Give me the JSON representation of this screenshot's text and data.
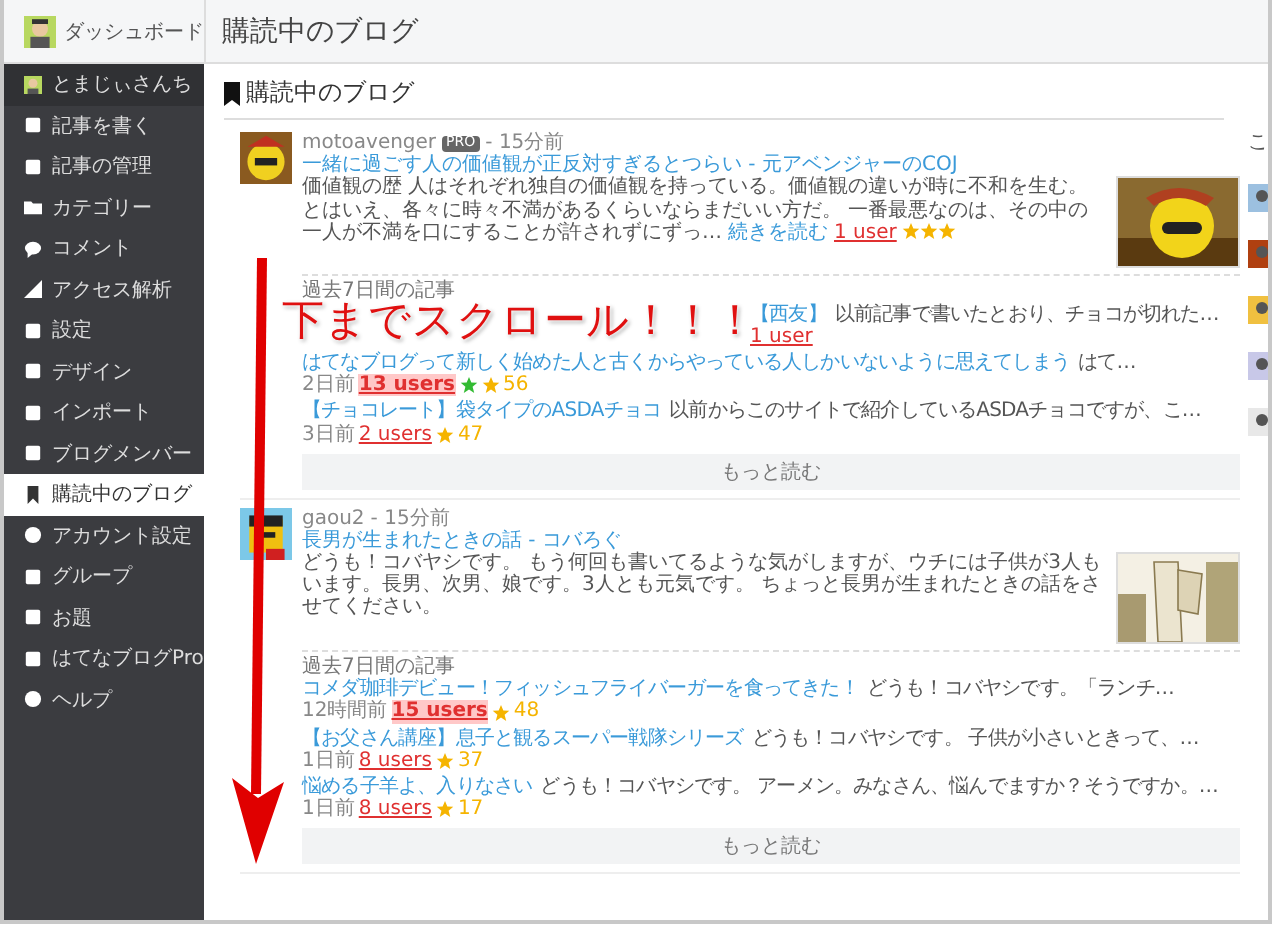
{
  "header": {
    "dashboard_label": "ダッシュボード",
    "title": "購読中のブログ"
  },
  "sidebar": {
    "items": [
      {
        "label": "とまじぃさんち",
        "selected": false
      },
      {
        "label": "記事を書く",
        "selected": false
      },
      {
        "label": "記事の管理",
        "selected": false
      },
      {
        "label": "カテゴリー",
        "selected": false
      },
      {
        "label": "コメント",
        "selected": false
      },
      {
        "label": "アクセス解析",
        "selected": false
      },
      {
        "label": "設定",
        "selected": false
      },
      {
        "label": "デザイン",
        "selected": false
      },
      {
        "label": "インポート",
        "selected": false
      },
      {
        "label": "ブログメンバー",
        "selected": false
      },
      {
        "label": "購読中のブログ",
        "selected": true
      },
      {
        "label": "アカウント設定",
        "selected": false
      },
      {
        "label": "グループ",
        "selected": false
      },
      {
        "label": "お題",
        "selected": false
      },
      {
        "label": "はてなブログPro",
        "selected": false
      },
      {
        "label": "ヘルプ",
        "selected": false
      }
    ]
  },
  "main": {
    "heading": "購読中のブログ",
    "annotation": "下までスクロール！！！",
    "right_column_text": "こ",
    "feeds": [
      {
        "author": "motoavenger",
        "pro_badge": "PRO",
        "time": "- 15分前",
        "title": "一緒に過ごす人の価値観が正反対すぎるとつらい - 元アベンジャーのCOJ",
        "excerpt": "価値観の歴 人はそれぞれ独自の価値観を持っている。価値観の違いが時に不和を生む。とはいえ、各々に時々不満があるくらいならまだいい方だ。 一番最悪なのは、その中の一人が不満を口にすることが許されずにずっ…",
        "read_more": "続きを読む",
        "users": "1 user",
        "stars": 3,
        "recent_label": "過去7日間の記事",
        "more": "もっと読む",
        "recent": [
          {
            "title": "【西友】",
            "excerpt": "以前記事で書いたとおり、チョコが切れた…",
            "users": "1 user",
            "hot": false,
            "green_star": false,
            "covered": true
          },
          {
            "title": "はてなブログって新しく始めた人と古くからやっている人しかいないように思えてしまう",
            "excerpt": "はて…",
            "age": "2日前",
            "users": "13 users",
            "hot": true,
            "star_count": "56",
            "green_star": true,
            "covered": false
          },
          {
            "title": "【チョコレート】袋タイプのASDAチョコ",
            "excerpt": "以前からこのサイトで紹介しているASDAチョコですが、こ…",
            "age": "3日前",
            "users": "2 users",
            "hot": false,
            "star_count": "47",
            "green_star": false,
            "covered": false
          }
        ]
      },
      {
        "author": "gaou2",
        "time": "- 15分前",
        "title": "長男が生まれたときの話 - コバろぐ",
        "excerpt": "どうも！コバヤシです。 もう何回も書いてるような気がしますが、ウチには子供が3人もいます。長男、次男、娘です。3人とも元気です。 ちょっと長男が生まれたときの話をさせてください。",
        "recent_label": "過去7日間の記事",
        "more": "もっと読む",
        "recent": [
          {
            "title": "コメダ珈琲デビュー！フィッシュフライバーガーを食ってきた！",
            "excerpt": "どうも！コバヤシです。「ランチ…",
            "age": "12時間前",
            "users": "15 users",
            "hot": true,
            "star_count": "48",
            "green_star": false,
            "covered": false
          },
          {
            "title": "【お父さん講座】息子と観るスーパー戦隊シリーズ",
            "excerpt": "どうも！コバヤシです。 子供が小さいときって、…",
            "age": "1日前",
            "users": "8 users",
            "hot": false,
            "star_count": "37",
            "green_star": false,
            "covered": false
          },
          {
            "title": "悩める子羊よ、入りなさい",
            "excerpt": "どうも！コバヤシです。 アーメン。みなさん、悩んでますか？そうですか。…",
            "age": "1日前",
            "users": "8 users",
            "hot": false,
            "star_count": "17",
            "green_star": false,
            "covered": false
          }
        ]
      }
    ]
  }
}
